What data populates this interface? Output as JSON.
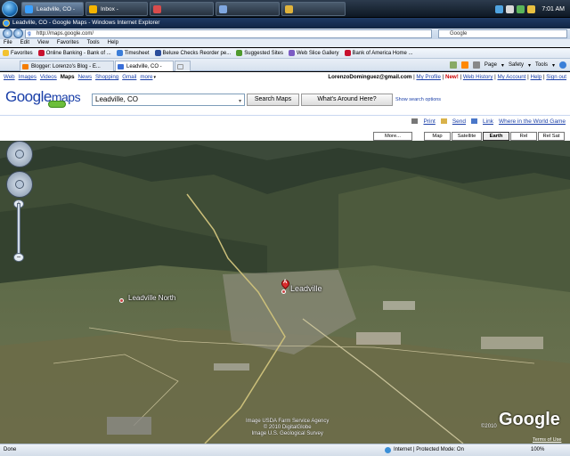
{
  "taskbar": {
    "buttons": [
      {
        "label": "Leadville, CO - Goo...",
        "active": true
      },
      {
        "label": "Inbox - Microsoft O...",
        "active": false
      },
      {
        "label": "",
        "active": false
      },
      {
        "label": "",
        "active": false
      },
      {
        "label": "",
        "active": false
      }
    ],
    "clock": "7:01 AM"
  },
  "ie": {
    "title": "Leadville, CO - Google Maps - Windows Internet Explorer",
    "address": "http://maps.google.com/",
    "search_engine": "Google",
    "menu": [
      "File",
      "Edit",
      "View",
      "Favorites",
      "Tools",
      "Help"
    ],
    "favorites_label": "Favorites",
    "favorites": [
      {
        "label": "Online Banking - Bank of ...",
        "color": "#c8102e"
      },
      {
        "label": "Timesheet",
        "color": "#3b7dd8"
      },
      {
        "label": "Beluxe Checks Reorder pe...",
        "color": "#2a4d9b"
      },
      {
        "label": "Suggested Sites",
        "color": "#4f9a2e"
      },
      {
        "label": "Web Slice Gallery",
        "color": "#7c5cc4"
      },
      {
        "label": "Bank of America  Home ...",
        "color": "#c8102e"
      }
    ],
    "tabs": [
      {
        "label": "Blogger: Lorenzo's Blog - E...",
        "active": false,
        "color": "#f57d00"
      },
      {
        "label": "Leadville, CO - Google ...",
        "active": true,
        "color": "#3a6fd8"
      },
      {
        "label": "",
        "active": false,
        "color": "#ffffff"
      }
    ],
    "commands": [
      "Page",
      "Safety",
      "Tools"
    ]
  },
  "gmaps": {
    "nav": [
      "Web",
      "Images",
      "Videos",
      "Maps",
      "News",
      "Shopping",
      "Gmail",
      "more"
    ],
    "current": "Maps",
    "user_email": "LorenzoDominguez@gmail.com",
    "user_links": [
      "My Profile",
      "New!",
      "Web History",
      "My Account",
      "Help",
      "Sign out"
    ],
    "logo_google": "Google",
    "logo_maps": "maps",
    "query": "Leadville, CO",
    "search_button": "Search Maps",
    "around_button": "What's Around Here?",
    "search_options": "Show search options",
    "page_links": [
      "Print",
      "Send",
      "Link",
      "Where in the World Game"
    ],
    "map_types": [
      {
        "label": "More...",
        "selected": false
      },
      {
        "label": "Map",
        "selected": false
      },
      {
        "label": "Satellite",
        "selected": false
      },
      {
        "label": "Earth",
        "selected": true
      },
      {
        "label": "Rel Map",
        "selected": false
      },
      {
        "label": "Rel Sat",
        "selected": false
      }
    ]
  },
  "earth": {
    "marker_letter": "A",
    "places": [
      {
        "label": "Leadville North"
      },
      {
        "label": "Leadville"
      }
    ],
    "copyright_lines": [
      "Image USDA Farm Service Agency",
      "© 2010 DigitalGlobe",
      "Image U.S. Geological Survey"
    ],
    "year": "©2010",
    "brand": "Google",
    "terms": "Terms of Use"
  },
  "status": {
    "left": "Done",
    "zone": "Internet | Protected Mode: On",
    "zoom": "100%"
  }
}
